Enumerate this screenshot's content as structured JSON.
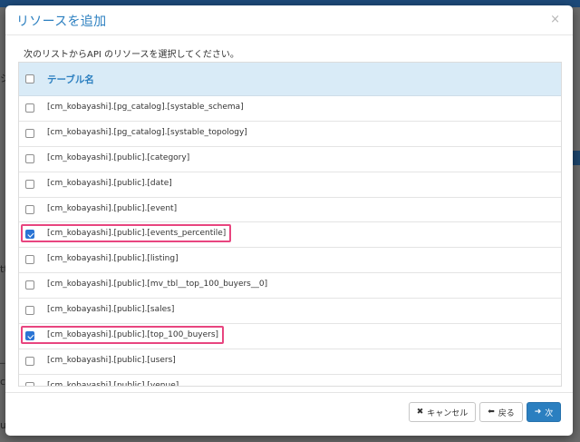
{
  "background": {
    "fragments": [
      "シ",
      "ttio",
      "_a",
      "ca",
      "ud"
    ]
  },
  "dialog": {
    "title": "リソースを追加",
    "close_glyph": "×",
    "instruction": "次のリストからAPI のリソースを選択してください。",
    "table": {
      "header": "テーブル名",
      "rows": [
        {
          "name": "[cm_kobayashi].[pg_catalog].[systable_schema]",
          "checked": false
        },
        {
          "name": "[cm_kobayashi].[pg_catalog].[systable_topology]",
          "checked": false
        },
        {
          "name": "[cm_kobayashi].[public].[category]",
          "checked": false
        },
        {
          "name": "[cm_kobayashi].[public].[date]",
          "checked": false
        },
        {
          "name": "[cm_kobayashi].[public].[event]",
          "checked": false
        },
        {
          "name": "[cm_kobayashi].[public].[events_percentile]",
          "checked": true
        },
        {
          "name": "[cm_kobayashi].[public].[listing]",
          "checked": false
        },
        {
          "name": "[cm_kobayashi].[public].[mv_tbl__top_100_buyers__0]",
          "checked": false
        },
        {
          "name": "[cm_kobayashi].[public].[sales]",
          "checked": false
        },
        {
          "name": "[cm_kobayashi].[public].[top_100_buyers]",
          "checked": true
        },
        {
          "name": "[cm_kobayashi].[public].[users]",
          "checked": false
        },
        {
          "name": "[cm_kobayashi].[public].[venue]",
          "checked": false
        }
      ]
    },
    "buttons": {
      "cancel": "キャンセル",
      "back": "戻る",
      "next": "次"
    },
    "icons": {
      "cancel": "close-icon",
      "back": "arrow-left-icon",
      "next": "arrow-right-icon"
    },
    "colors": {
      "accent": "#2b7fc0",
      "header_bg": "#d9ebf7",
      "highlight": "#e8457f",
      "checkbox_checked": "#2a74d4"
    }
  }
}
